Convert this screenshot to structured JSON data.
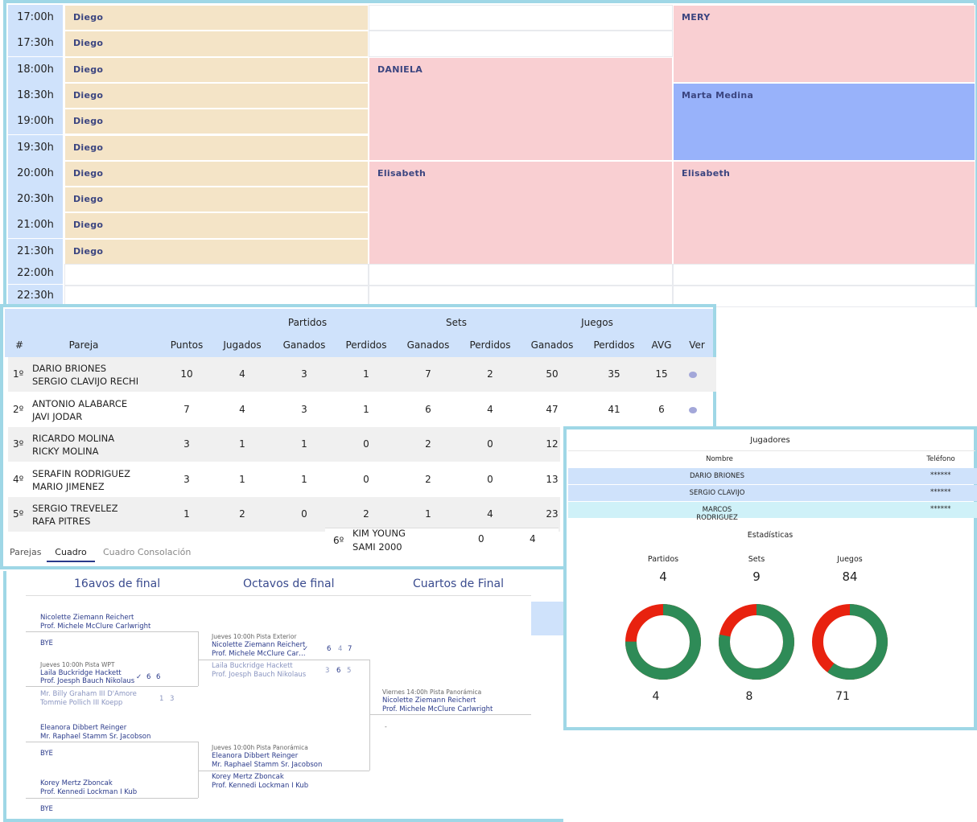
{
  "schedule": {
    "times": [
      "17:00h",
      "17:30h",
      "18:00h",
      "18:30h",
      "19:00h",
      "19:30h",
      "20:00h",
      "20:30h",
      "21:00h",
      "21:30h",
      "22:00h",
      "22:30h"
    ],
    "col1": [
      "Diego",
      "Diego",
      "Diego",
      "Diego",
      "Diego",
      "Diego",
      "Diego",
      "Diego",
      "Diego",
      "Diego"
    ],
    "col2": [
      "DANIELA",
      "Elisabeth"
    ],
    "col3": [
      "MERY",
      "Marta Medina",
      "Elisabeth"
    ],
    "colors": {
      "beige": "#f4e4c7",
      "pink": "#f9cfd2",
      "blue": "#98b2fa",
      "time": "#cfe2fb"
    }
  },
  "standings": {
    "group_headers": [
      "Partidos",
      "Sets",
      "Juegos"
    ],
    "columns": [
      "#",
      "Pareja",
      "Puntos",
      "Jugados",
      "Ganados",
      "Perdidos",
      "Ganados",
      "Perdidos",
      "Ganados",
      "Perdidos",
      "AVG",
      "Ver"
    ],
    "rows": [
      {
        "pos": "1º",
        "p1": "DARIO BRIONES",
        "p2": "SERGIO CLAVIJO RECHI",
        "v": [
          "10",
          "4",
          "3",
          "1",
          "7",
          "2",
          "50",
          "35",
          "15"
        ]
      },
      {
        "pos": "2º",
        "p1": "ANTONIO ALABARCE",
        "p2": "JAVI JODAR",
        "v": [
          "7",
          "4",
          "3",
          "1",
          "6",
          "4",
          "47",
          "41",
          "6"
        ]
      },
      {
        "pos": "3º",
        "p1": "RICARDO MOLINA",
        "p2": "RICKY MOLINA",
        "v": [
          "3",
          "1",
          "1",
          "0",
          "2",
          "0",
          "12"
        ]
      },
      {
        "pos": "4º",
        "p1": "SERAFIN RODRIGUEZ",
        "p2": "MARIO JIMENEZ",
        "v": [
          "3",
          "1",
          "1",
          "0",
          "2",
          "0",
          "13"
        ]
      },
      {
        "pos": "5º",
        "p1": "SERGIO TREVELEZ",
        "p2": "RAFA PITRES",
        "v": [
          "1",
          "2",
          "0",
          "2",
          "1",
          "4",
          "23"
        ]
      }
    ],
    "partial_row": {
      "pos": "6º",
      "p1": "KIM YOUNG",
      "p2": "SAMI 2000",
      "v": [
        "0",
        "4"
      ]
    },
    "tabs": [
      "Parejas",
      "Cuadro",
      "Cuadro Consolación"
    ]
  },
  "bracket": {
    "rounds": [
      "16avos de final",
      "Octavos de final",
      "Cuartos de Final"
    ],
    "r1": [
      {
        "a": "Nicolette Ziemann Reichert",
        "b": "Prof. Michele McClure Carlwright"
      },
      {
        "a": "BYE"
      },
      {
        "info": "Jueves 10:00h Pista WPT",
        "a": "Laila Buckridge Hackett",
        "b": "Prof. Joesph Bauch Nikolaus",
        "s": [
          "6",
          "6"
        ]
      },
      {
        "a": "Mr. Billy Graham III D'Amore",
        "b": "Tommie Pollich III Koepp",
        "s": [
          "1",
          "3"
        ]
      },
      {
        "a": "Eleanora Dibbert Reinger",
        "b": "Mr. Raphael Stamm Sr. Jacobson"
      },
      {
        "a": "BYE"
      },
      {
        "a": "Korey Mertz Zboncak",
        "b": "Prof. Kennedi Lockman I Kub"
      },
      {
        "a": "BYE"
      }
    ],
    "r2": [
      {
        "info": "Jueves 10:00h Pista Exterior",
        "a": "Nicolette Ziemann Reichert",
        "b": "Prof. Michele McClure Car…",
        "s": [
          "6",
          "4",
          "7"
        ]
      },
      {
        "a": "Laila Buckridge Hackett",
        "b": "Prof. Joesph Bauch Nikolaus",
        "s": [
          "3",
          "6",
          "5"
        ]
      },
      {
        "info": "Jueves 10:00h Pista Panorámica",
        "a": "Eleanora Dibbert Reinger",
        "b": "Mr. Raphael Stamm Sr. Jacobson"
      },
      {
        "a": "Korey Mertz Zboncak",
        "b": "Prof. Kennedi Lockman I Kub"
      }
    ],
    "r3": [
      {
        "info": "Viernes 14:00h Pista Panorámica",
        "a": "Nicolette Ziemann Reichert",
        "b": "Prof. Michele McClure Carlwright"
      },
      {
        "a": "-"
      }
    ]
  },
  "players": {
    "title": "Jugadores",
    "col_name": "Nombre",
    "col_phone": "Teléfono",
    "rows": [
      {
        "name": "DARIO BRIONES",
        "phone": "******"
      },
      {
        "name": "SERGIO CLAVIJO",
        "phone": "******"
      },
      {
        "name": "MARCOS RODRIGUEZ",
        "phone": "******"
      }
    ],
    "stats_title": "Estadísticas",
    "stats": [
      {
        "label": "Partidos",
        "total": "4",
        "won": "4",
        "frac_won": 0.75
      },
      {
        "label": "Sets",
        "total": "9",
        "won": "8",
        "frac_won": 0.78
      },
      {
        "label": "Juegos",
        "total": "84",
        "won": "71",
        "frac_won": 0.6
      }
    ],
    "colors": {
      "won": "#2e8b57",
      "lost": "#e8220f"
    }
  }
}
